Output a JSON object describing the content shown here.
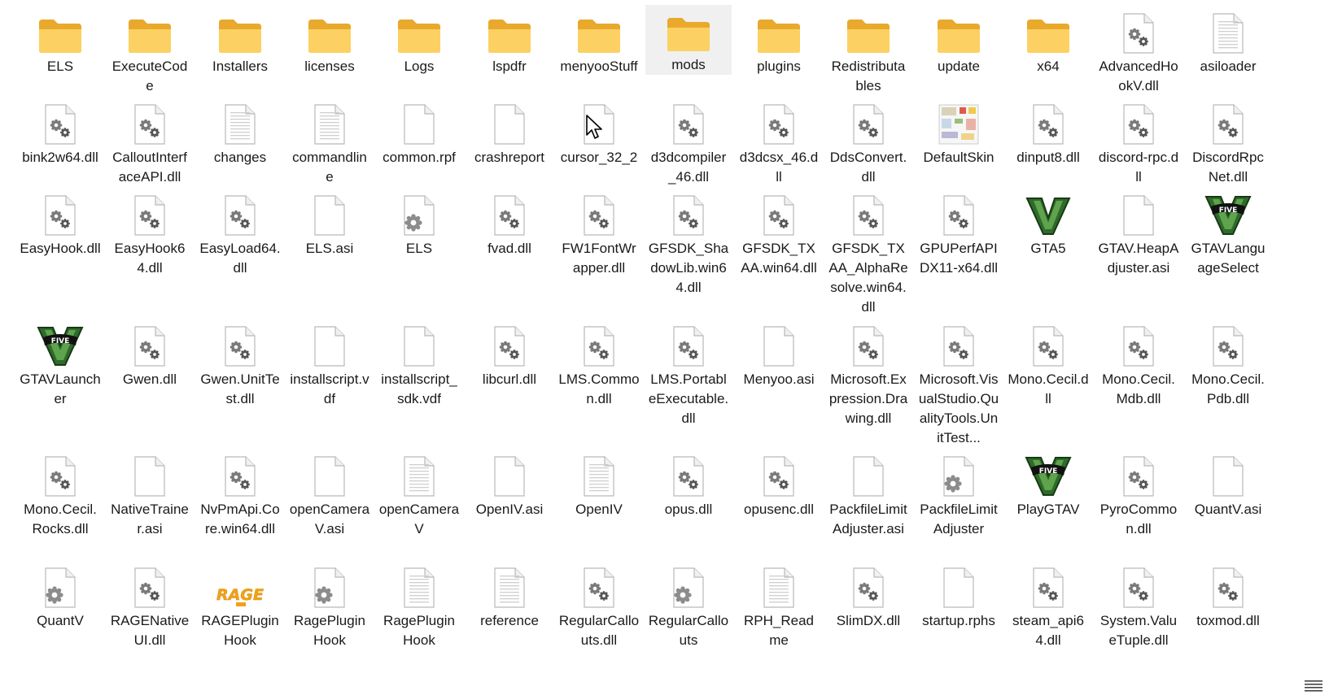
{
  "items": [
    {
      "name": "ELS",
      "type": "folder"
    },
    {
      "name": "ExecuteCode",
      "type": "folder-code"
    },
    {
      "name": "Installers",
      "type": "folder-r"
    },
    {
      "name": "licenses",
      "type": "folder"
    },
    {
      "name": "Logs",
      "type": "folder"
    },
    {
      "name": "lspdfr",
      "type": "folder"
    },
    {
      "name": "menyooStuff",
      "type": "folder"
    },
    {
      "name": "mods",
      "type": "folder-empty",
      "selected": true
    },
    {
      "name": "plugins",
      "type": "folder-gear"
    },
    {
      "name": "Redistributables",
      "type": "folder-r"
    },
    {
      "name": "update",
      "type": "folder"
    },
    {
      "name": "x64",
      "type": "folder"
    },
    {
      "name": "AdvancedHookV.dll",
      "type": "dll"
    },
    {
      "name": "asiloader",
      "type": "text"
    },
    {
      "name": "bink2w64.dll",
      "type": "dll"
    },
    {
      "name": "CalloutInterfaceAPI.dll",
      "type": "dll"
    },
    {
      "name": "changes",
      "type": "text"
    },
    {
      "name": "commandline",
      "type": "text"
    },
    {
      "name": "common.rpf",
      "type": "blank"
    },
    {
      "name": "crashreport",
      "type": "blank"
    },
    {
      "name": "cursor_32_2",
      "type": "cursor"
    },
    {
      "name": "d3dcompiler_46.dll",
      "type": "dll"
    },
    {
      "name": "d3dcsx_46.dll",
      "type": "dll"
    },
    {
      "name": "DdsConvert.dll",
      "type": "dll"
    },
    {
      "name": "DefaultSkin",
      "type": "skin"
    },
    {
      "name": "dinput8.dll",
      "type": "dll"
    },
    {
      "name": "discord-rpc.dll",
      "type": "dll"
    },
    {
      "name": "DiscordRpcNet.dll",
      "type": "dll"
    },
    {
      "name": "EasyHook.dll",
      "type": "dll"
    },
    {
      "name": "EasyHook64.dll",
      "type": "dll"
    },
    {
      "name": "EasyLoad64.dll",
      "type": "dll"
    },
    {
      "name": "ELS.asi",
      "type": "blank"
    },
    {
      "name": "ELS",
      "type": "config"
    },
    {
      "name": "fvad.dll",
      "type": "dll"
    },
    {
      "name": "FW1FontWrapper.dll",
      "type": "dll"
    },
    {
      "name": "GFSDK_ShadowLib.win64.dll",
      "type": "dll"
    },
    {
      "name": "GFSDK_TXAA.win64.dll",
      "type": "dll"
    },
    {
      "name": "GFSDK_TXAA_AlphaResolve.win64.dll",
      "type": "dll"
    },
    {
      "name": "GPUPerfAPIDX11-x64.dll",
      "type": "dll"
    },
    {
      "name": "GTA5",
      "type": "gtav"
    },
    {
      "name": "GTAV.HeapAdjuster.asi",
      "type": "blank"
    },
    {
      "name": "GTAVLanguageSelect",
      "type": "gtav-five"
    },
    {
      "name": "GTAVLauncher",
      "type": "gtav-five"
    },
    {
      "name": "Gwen.dll",
      "type": "dll"
    },
    {
      "name": "Gwen.UnitTest.dll",
      "type": "dll"
    },
    {
      "name": "installscript.vdf",
      "type": "blank"
    },
    {
      "name": "installscript_sdk.vdf",
      "type": "blank"
    },
    {
      "name": "libcurl.dll",
      "type": "dll"
    },
    {
      "name": "LMS.Common.dll",
      "type": "dll"
    },
    {
      "name": "LMS.PortableExecutable.dll",
      "type": "dll"
    },
    {
      "name": "Menyoo.asi",
      "type": "blank"
    },
    {
      "name": "Microsoft.Expression.Drawing.dll",
      "type": "dll"
    },
    {
      "name": "Microsoft.VisualStudio.QualityTools.UnitTest...",
      "type": "dll"
    },
    {
      "name": "Mono.Cecil.dll",
      "type": "dll"
    },
    {
      "name": "Mono.Cecil.Mdb.dll",
      "type": "dll"
    },
    {
      "name": "Mono.Cecil.Pdb.dll",
      "type": "dll"
    },
    {
      "name": "Mono.Cecil.Rocks.dll",
      "type": "dll"
    },
    {
      "name": "NativeTrainer.asi",
      "type": "blank"
    },
    {
      "name": "NvPmApi.Core.win64.dll",
      "type": "dll"
    },
    {
      "name": "openCameraV.asi",
      "type": "blank"
    },
    {
      "name": "openCameraV",
      "type": "text"
    },
    {
      "name": "OpenIV.asi",
      "type": "blank"
    },
    {
      "name": "OpenIV",
      "type": "text"
    },
    {
      "name": "opus.dll",
      "type": "dll"
    },
    {
      "name": "opusenc.dll",
      "type": "dll"
    },
    {
      "name": "PackfileLimitAdjuster.asi",
      "type": "blank"
    },
    {
      "name": "PackfileLimitAdjuster",
      "type": "config"
    },
    {
      "name": "PlayGTAV",
      "type": "gtav-five"
    },
    {
      "name": "PyroCommon.dll",
      "type": "dll"
    },
    {
      "name": "QuantV.asi",
      "type": "blank"
    },
    {
      "name": "QuantV",
      "type": "config"
    },
    {
      "name": "RAGENativeUI.dll",
      "type": "dll"
    },
    {
      "name": "RAGEPluginHook",
      "type": "rage"
    },
    {
      "name": "RagePluginHook",
      "type": "config"
    },
    {
      "name": "RagePluginHook",
      "type": "text"
    },
    {
      "name": "reference",
      "type": "text"
    },
    {
      "name": "RegularCallouts.dll",
      "type": "dll"
    },
    {
      "name": "RegularCallouts",
      "type": "config"
    },
    {
      "name": "RPH_Readme",
      "type": "text"
    },
    {
      "name": "SlimDX.dll",
      "type": "dll"
    },
    {
      "name": "startup.rphs",
      "type": "blank"
    },
    {
      "name": "steam_api64.dll",
      "type": "dll"
    },
    {
      "name": "System.ValueTuple.dll",
      "type": "dll"
    },
    {
      "name": "toxmod.dll",
      "type": "dll"
    }
  ],
  "icon_names": {
    "folder": "folder-icon",
    "folder-empty": "folder-icon",
    "folder-code": "folder-code-icon",
    "folder-r": "folder-rockstar-icon",
    "folder-gear": "folder-gear-icon",
    "dll": "dll-file-icon",
    "text": "text-file-icon",
    "blank": "blank-file-icon",
    "config": "config-file-icon",
    "cursor": "cursor-file-icon",
    "skin": "image-file-icon",
    "gtav": "gtav-logo-icon",
    "gtav-five": "gtav-five-logo-icon",
    "rage": "rage-logo-icon"
  },
  "rage_text": "RAGE",
  "five_text": "FIVE",
  "colors": {
    "folder_back": "#e8a92c",
    "folder_front": "#fcd062",
    "selection": "#f0f0f0",
    "gtav_green": "#2f6b2a"
  }
}
